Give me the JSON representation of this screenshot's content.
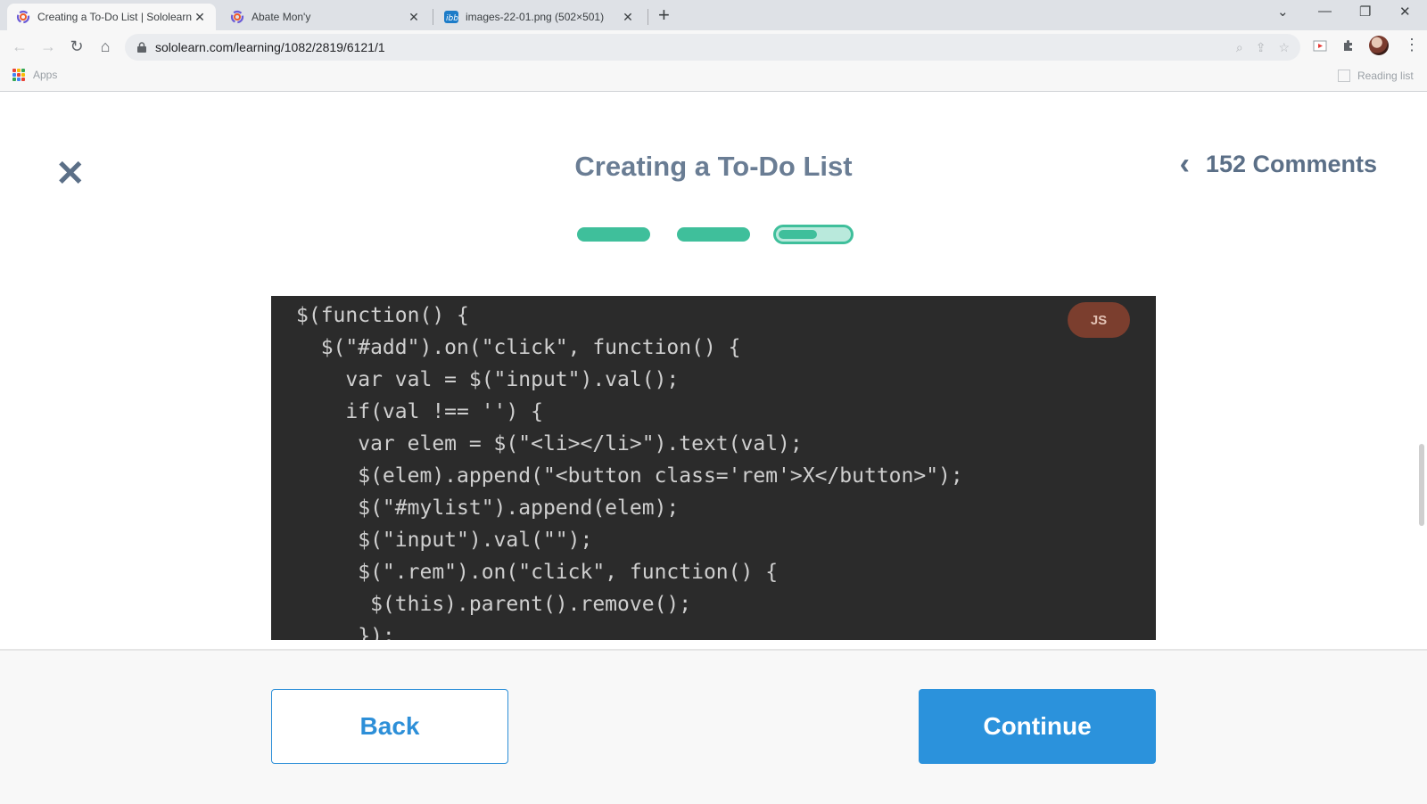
{
  "browser": {
    "tabs": [
      {
        "title": "Creating a To-Do List | Sololearn",
        "icon": "sololearn-icon",
        "active": true
      },
      {
        "title": "Abate Mon'y",
        "icon": "sololearn-icon",
        "active": false
      },
      {
        "title": "images-22-01.png (502×501)",
        "icon": "ibb-icon",
        "active": false
      }
    ],
    "new_tab": "+",
    "url": "sololearn.com/learning/1082/2819/6121/1",
    "bookmarks": {
      "apps": "Apps",
      "reading_list": "Reading list"
    },
    "colors": {
      "tabbar": "#dee1e6",
      "toolbar": "#f7f7f7"
    }
  },
  "lesson": {
    "close_icon": "close-icon",
    "title": "Creating a To-Do List",
    "comments_label": "152 Comments",
    "progress": {
      "total_steps": 3,
      "completed_steps": 2,
      "current_step_fraction": 0.55
    },
    "code": {
      "language_badge": "JS",
      "lines": [
        "$(function() {",
        "  $(\"#add\").on(\"click\", function() {",
        "    var val = $(\"input\").val();",
        "    if(val !== '') {",
        "     var elem = $(\"<li></li>\").text(val);",
        "     $(elem).append(\"<button class='rem'>X</button>\");",
        "     $(\"#mylist\").append(elem);",
        "     $(\"input\").val(\"\");",
        "     $(\".rem\").on(\"click\", function() {",
        "      $(this).parent().remove();",
        "     });"
      ]
    },
    "back_label": "Back",
    "continue_label": "Continue",
    "colors": {
      "accent_green": "#3fbf9b",
      "accent_blue": "#2b92dc",
      "title": "#6a7d94",
      "code_bg": "#2b2b2b",
      "badge": "#7b3e2e"
    }
  }
}
